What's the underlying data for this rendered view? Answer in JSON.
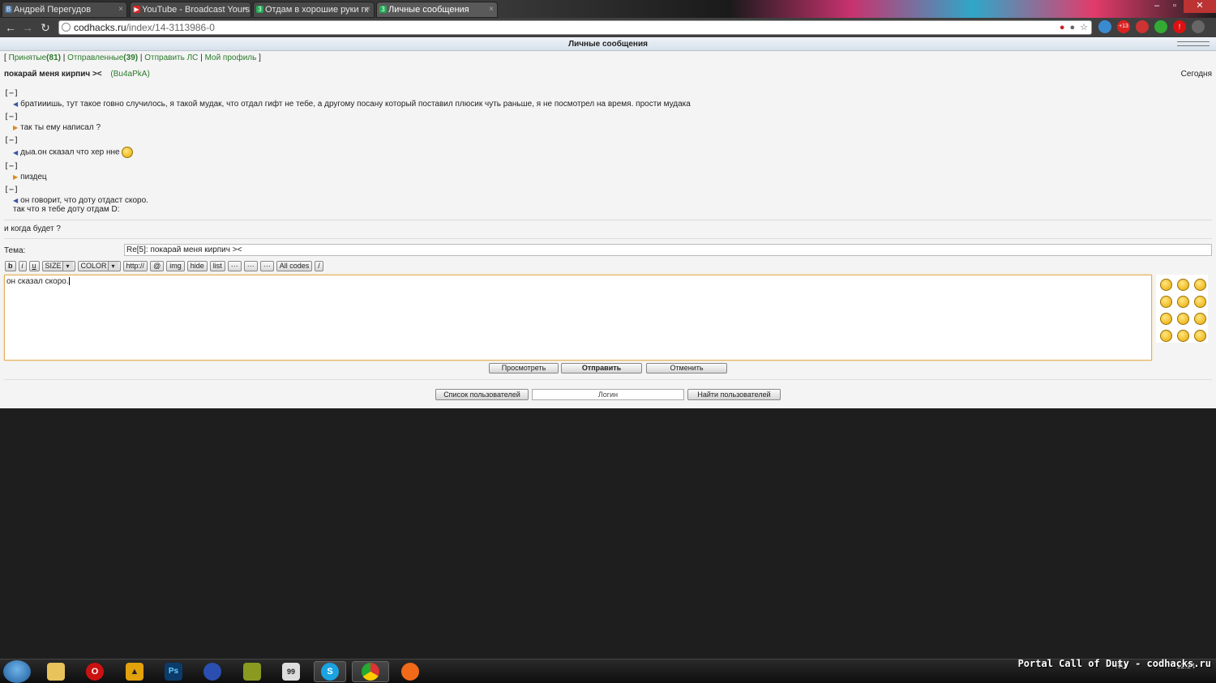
{
  "browser": {
    "tabs": [
      {
        "label": "Андрей Перегудов",
        "icon": "vk-icon"
      },
      {
        "label": "YouTube - Broadcast Yours",
        "icon": "youtube-icon"
      },
      {
        "label": "Отдам в хорошие руки гк",
        "icon": "codhacks-icon"
      },
      {
        "label": "Личные сообщения",
        "icon": "codhacks-icon"
      }
    ],
    "url_host": "codhacks.ru",
    "url_path": "/index/14-3113986-0",
    "ext_badge": "+13"
  },
  "page": {
    "title": "Личные сообщения",
    "nav": {
      "inbox_label": "Принятые",
      "inbox_count": "(81)",
      "sent_label": "Отправленные",
      "sent_count": "(39)",
      "send_label": "Отправить ЛС",
      "profile_label": "Мой профиль"
    },
    "thread": {
      "title": "покарай меня кирпич ><",
      "user": "(Bu4aPkA)",
      "date": "Сегодня"
    },
    "toggle_label": "[−]",
    "messages": [
      {
        "direction": "in",
        "text": "братииишь, тут такое говно случилось, я такой мудак, что отдал гифт не тебе, а другому посану который поставил плюсик чуть раньше, я не посмотрел на время. прости мудака"
      },
      {
        "direction": "out",
        "text": "так ты ему написал ?"
      },
      {
        "direction": "in",
        "text": "дыа.он сказал что хер нне"
      },
      {
        "direction": "out",
        "text": "пиздец"
      },
      {
        "direction": "in",
        "text": "он говорит, что доту отдаст скоро.",
        "text2": "так что я тебе доту отдам D:"
      }
    ],
    "reply_text": "и когда будет ?",
    "subject_label": "Тема:",
    "subject_value": "Re[5]: покарай меня кирпич ><",
    "bbcode": {
      "b": "b",
      "i": "i",
      "u": "u",
      "size": "SIZE",
      "color": "COLOR",
      "http": "http://",
      "at": "@",
      "img": "img",
      "hide": "hide",
      "list": "list",
      "dots1": "···",
      "dots2": "···",
      "dots3": "···",
      "all": "All codes",
      "slash": "/"
    },
    "editor_text": "он сказал скоро.",
    "buttons": {
      "preview": "Просмотреть",
      "send": "Отправить",
      "cancel": "Отменить"
    },
    "footer": {
      "user_list": "Список пользователей",
      "login_placeholder": "Логин",
      "find_user": "Найти пользователей"
    }
  },
  "taskbar": {
    "apps": [
      "opera-icon",
      "aimp-icon",
      "photoshop-icon",
      "browser-globe-icon",
      "game-icon",
      "notepad-icon",
      "skype-icon",
      "chrome-icon",
      "origin-icon"
    ],
    "lang": "RU",
    "time": "12:24"
  },
  "watermark": "Portal Call of Duty - codhacks.ru"
}
